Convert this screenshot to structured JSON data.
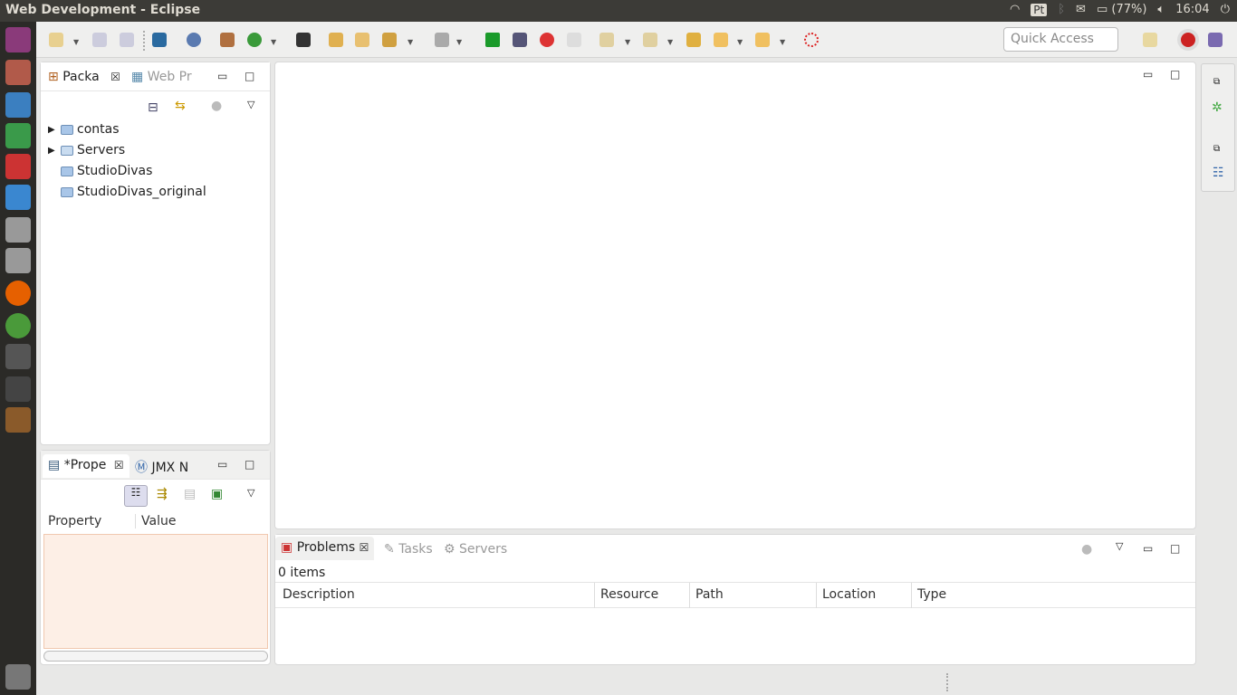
{
  "window": {
    "title": "Web Development - Eclipse"
  },
  "tray": {
    "keyboard": "Pt",
    "battery": "(77%)",
    "time": "16:04"
  },
  "toolbar": {
    "quick_access_placeholder": "Quick Access"
  },
  "package_explorer": {
    "tabs": [
      {
        "label": "Packa",
        "active": true
      },
      {
        "label": "Web Pr",
        "active": false
      }
    ],
    "items": [
      {
        "label": "contas",
        "expandable": true
      },
      {
        "label": "Servers",
        "expandable": true
      },
      {
        "label": "StudioDivas",
        "expandable": false
      },
      {
        "label": "StudioDivas_original",
        "expandable": false
      }
    ]
  },
  "properties": {
    "tabs": [
      {
        "label": "*Prope",
        "active": true
      },
      {
        "label": "JMX N",
        "active": false
      }
    ],
    "columns": [
      "Property",
      "Value"
    ]
  },
  "problems": {
    "tabs": [
      {
        "label": "Problems",
        "active": true
      },
      {
        "label": "Tasks",
        "active": false
      },
      {
        "label": "Servers",
        "active": false
      }
    ],
    "count": "0 items",
    "columns": [
      "Description",
      "Resource",
      "Path",
      "Location",
      "Type"
    ]
  }
}
